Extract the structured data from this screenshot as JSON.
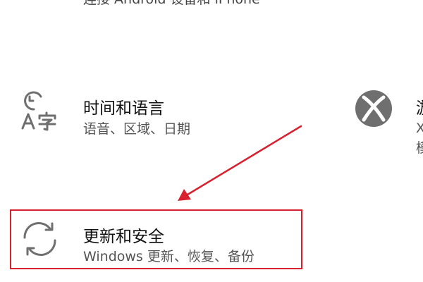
{
  "top_text": "连接 Android 设备和 iPhone",
  "tiles": [
    {
      "key": "time_language",
      "title": "时间和语言",
      "desc": "语音、区域、日期",
      "icon": "time-language-icon"
    },
    {
      "key": "gaming",
      "title": "游",
      "desc": "X\n模",
      "icon": "xbox-icon"
    },
    {
      "key": "update_security",
      "title": "更新和安全",
      "desc": "Windows 更新、恢复、备份",
      "icon": "sync-icon"
    }
  ],
  "colors": {
    "highlight_border": "#d8202f",
    "arrow": "#d8202f",
    "icon": "#6f6f6f"
  }
}
